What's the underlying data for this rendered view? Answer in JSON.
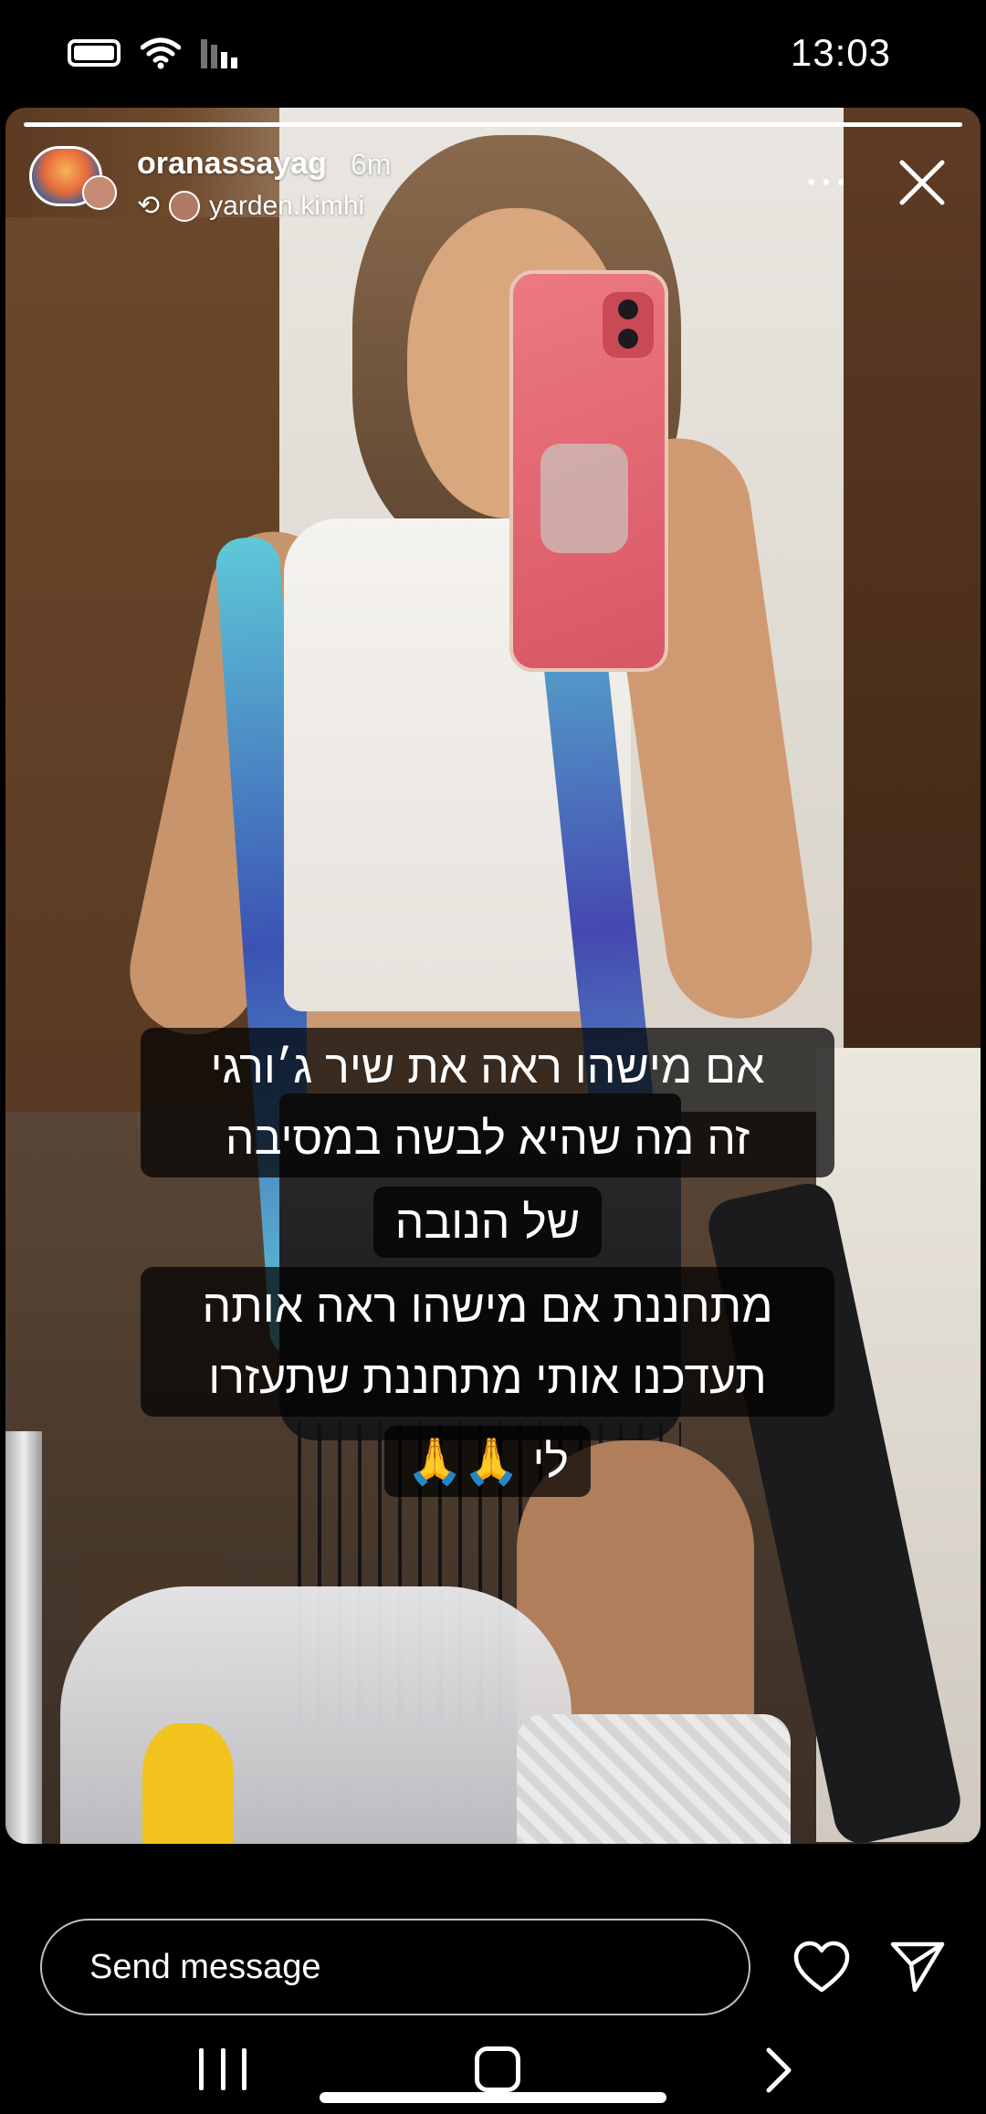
{
  "status_bar": {
    "time": "13:03",
    "icons": [
      "battery-icon",
      "wifi-icon",
      "signal-icon"
    ]
  },
  "story": {
    "progress": 1.0,
    "username": "oranassayag",
    "time_ago": "6m",
    "reposted_from": "yarden.kimhi",
    "more_label": "···",
    "caption_block_1": [
      "אם מישהו ראה את שיר ג׳ורגי",
      "זה מה שהיא לבשה במסיבה",
      "של הנובה"
    ],
    "caption_block_2": [
      "מתחננת אם מישהו ראה אותה",
      "תעדכנו אותי מתחננת שתעזרו",
      "לי 🙏🙏"
    ]
  },
  "reply_bar": {
    "placeholder": "Send message"
  },
  "colors": {
    "background": "#000000",
    "text": "#ffffff"
  }
}
